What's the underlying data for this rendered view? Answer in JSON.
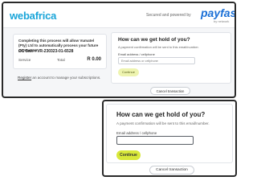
{
  "screen1": {
    "header": {
      "logo_text": "webafrica",
      "secured_text": "Secured and powered by",
      "payfast_logo": "payfast",
      "payfast_sub": "by network"
    },
    "order": {
      "description": "Completing this process will allow Vumatel (Pty) Ltd to automatically process your future payments.",
      "reference": "CC Sale #VR-230323-01-6528",
      "service_label": "Service",
      "total_label": "Total",
      "amount": "R 0.00"
    },
    "register": {
      "link": "Register",
      "text": "an account to manage your subscriptions."
    },
    "contact": {
      "title": "How can we get hold of you?",
      "note": "A payment confirmation will be sent to this email/number.",
      "field_label": "Email address / cellphone",
      "field_placeholder": "Email address or cellphone",
      "continue_label": "Continue"
    },
    "cancel_label": "Cancel transaction"
  },
  "screen2": {
    "contact": {
      "title": "How can we get hold of you?",
      "note": "A payment confirmation will be sent to this email/number.",
      "field_label": "Email address / cellphone",
      "field_value": "",
      "continue_label": "Continue"
    },
    "cancel_label": "Cancel transaction"
  },
  "colors": {
    "brand_webafrica": "#1aa5d9",
    "brand_payfast": "#1a6fd6",
    "continue_active": "#d8e83a",
    "continue_disabled": "#eef4b0"
  }
}
